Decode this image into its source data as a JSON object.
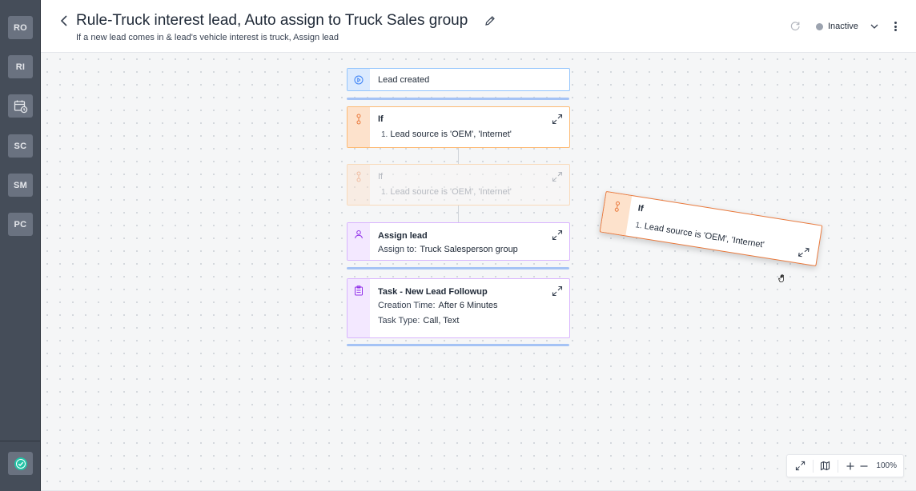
{
  "sidebar": {
    "items": [
      {
        "label": "RO"
      },
      {
        "label": "RI"
      },
      {
        "label": "",
        "icon": "calendar-clock-icon"
      },
      {
        "label": "SC"
      },
      {
        "label": "SM"
      },
      {
        "label": "PC"
      }
    ],
    "bottom_icon": "check-circle-icon"
  },
  "header": {
    "title": "Rule-Truck interest lead, Auto assign to Truck Sales group",
    "subtitle": "If a new lead comes in & lead's vehicle interest is truck, Assign lead",
    "status": "Inactive",
    "status_color": "#9ca3af"
  },
  "flow": {
    "trigger": {
      "label": "Lead created"
    },
    "condition": {
      "title": "If",
      "item_number": "1.",
      "item_text": "Lead source is 'OEM', 'Internet'"
    },
    "placeholder": {
      "title": "If",
      "item_number": "1.",
      "item_text": "Lead source is 'OEM', 'Internet'"
    },
    "assign": {
      "title": "Assign lead",
      "field_label": "Assign to:",
      "field_value": "Truck Salesperson group"
    },
    "task": {
      "title": "Task - New Lead Followup",
      "creation_label": "Creation Time:",
      "creation_value": "After 6 Minutes",
      "type_label": "Task Type:",
      "type_value": "Call, Text"
    },
    "dragging": {
      "title": "If",
      "item_number": "1.",
      "item_text": "Lead source is 'OEM', 'Internet'"
    }
  },
  "zoom": {
    "level": "100%"
  },
  "colors": {
    "sidebar": "#454d59",
    "trigger_border": "#93c5fd",
    "condition_border": "#fdba74",
    "action_border": "#d8b4fe",
    "drop_bar": "#a5c3f5"
  }
}
